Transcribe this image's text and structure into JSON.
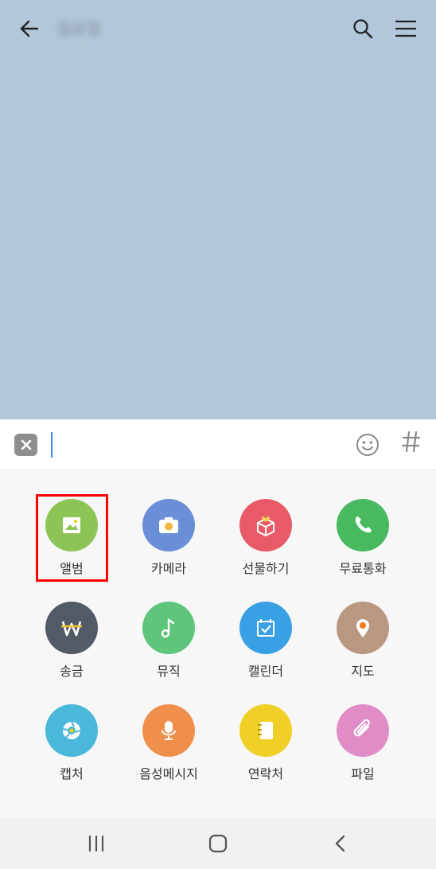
{
  "header": {
    "room_title": "일요일"
  },
  "input": {
    "placeholder": "",
    "value": ""
  },
  "attachments": [
    {
      "label": "앨범",
      "icon": "album-icon",
      "color": "#8cc556"
    },
    {
      "label": "카메라",
      "icon": "camera-icon",
      "color": "#6a8fd6"
    },
    {
      "label": "선물하기",
      "icon": "gift-icon",
      "color": "#e85a67"
    },
    {
      "label": "무료통화",
      "icon": "phone-icon",
      "color": "#48b95f"
    },
    {
      "label": "송금",
      "icon": "won-icon",
      "color": "#525a66"
    },
    {
      "label": "뮤직",
      "icon": "music-icon",
      "color": "#5ec57b"
    },
    {
      "label": "캘린더",
      "icon": "calendar-icon",
      "color": "#3aa0e6"
    },
    {
      "label": "지도",
      "icon": "map-pin-icon",
      "color": "#b99782"
    },
    {
      "label": "캡처",
      "icon": "capture-icon",
      "color": "#4ab8d8"
    },
    {
      "label": "음성메시지",
      "icon": "mic-icon",
      "color": "#f08f4c"
    },
    {
      "label": "연락처",
      "icon": "contacts-icon",
      "color": "#f0cf26"
    },
    {
      "label": "파일",
      "icon": "paperclip-icon",
      "color": "#e08cc6"
    }
  ],
  "colors": {
    "chat_background": "#b2c7da",
    "highlight": "#ff0000"
  }
}
